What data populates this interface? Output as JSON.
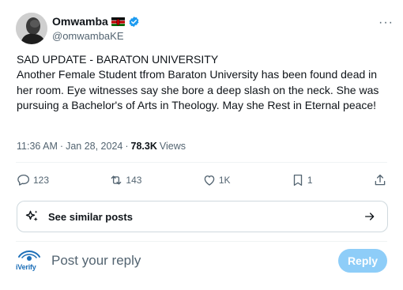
{
  "author": {
    "name": "Omwamba",
    "handle": "@omwambaKE",
    "flag_icon": "kenya-flag-icon",
    "verified_icon": "verified-badge-icon",
    "verified_color": "#1d9bf0"
  },
  "post": {
    "text": "SAD UPDATE - BARATON UNIVERSITY\nAnother Female Student tfrom Baraton University has been found dead in her  room. Eye witnesses say she bore a deep slash on the neck. She was pursuing a Bachelor's of Arts in Theology. May she Rest in Eternal peace!",
    "time": "11:36 AM",
    "separator": "·",
    "date": "Jan 28, 2024",
    "views_count": "78.3K",
    "views_label": "Views"
  },
  "actions": {
    "replies": "123",
    "reposts": "143",
    "likes": "1K",
    "bookmarks": "1"
  },
  "similar_posts": {
    "label": "See similar posts"
  },
  "reply": {
    "brand": "iVerify",
    "placeholder": "Post your reply",
    "button_label": "Reply",
    "button_color": "#8ecdf8"
  },
  "colors": {
    "text": "#0f1419",
    "secondary": "#536471",
    "border": "#cfd9de"
  }
}
